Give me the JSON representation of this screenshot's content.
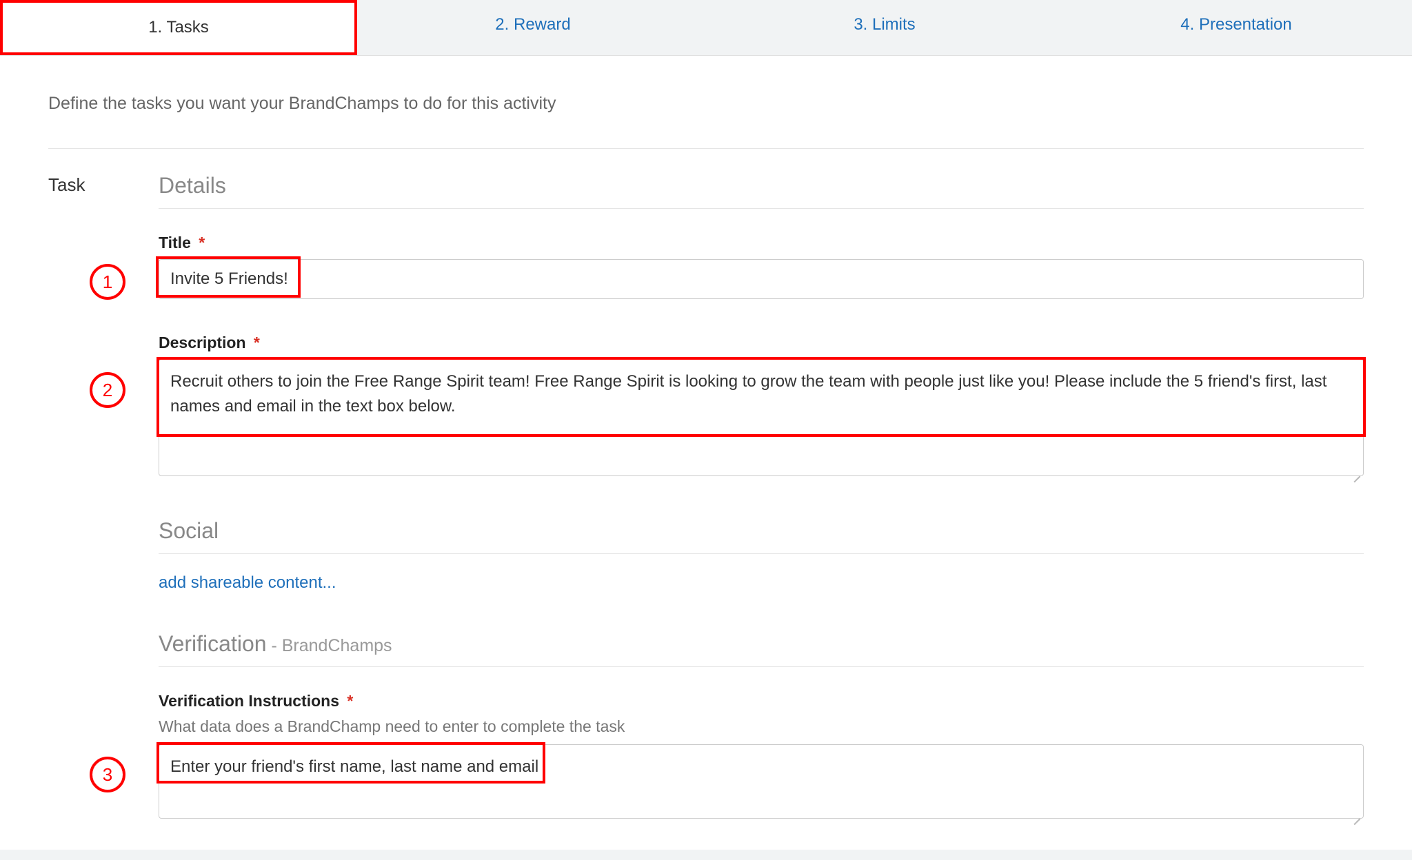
{
  "tabs": [
    {
      "label": "1. Tasks",
      "active": true
    },
    {
      "label": "2. Reward",
      "active": false
    },
    {
      "label": "3. Limits",
      "active": false
    },
    {
      "label": "4. Presentation",
      "active": false
    }
  ],
  "intro": "Define the tasks you want your BrandChamps to do for this activity",
  "task_label": "Task",
  "details_heading": "Details",
  "title_field": {
    "label": "Title",
    "required": "*",
    "value": "Invite 5 Friends!"
  },
  "description_field": {
    "label": "Description",
    "required": "*",
    "value": "Recruit others to join the Free Range Spirit team! Free Range Spirit is looking to grow the team with people just like you! Please include the 5 friend's first, last names and email in the text box below."
  },
  "social_heading": "Social",
  "add_shareable": "add shareable content...",
  "verification_heading": "Verification",
  "verification_sub": " - BrandChamps",
  "verification_instructions": {
    "label": "Verification Instructions",
    "required": "*",
    "help": "What data does a BrandChamp need to enter to complete the task",
    "value": "Enter your friend's first name, last name and email"
  },
  "markers": {
    "one": "1",
    "two": "2",
    "three": "3"
  }
}
